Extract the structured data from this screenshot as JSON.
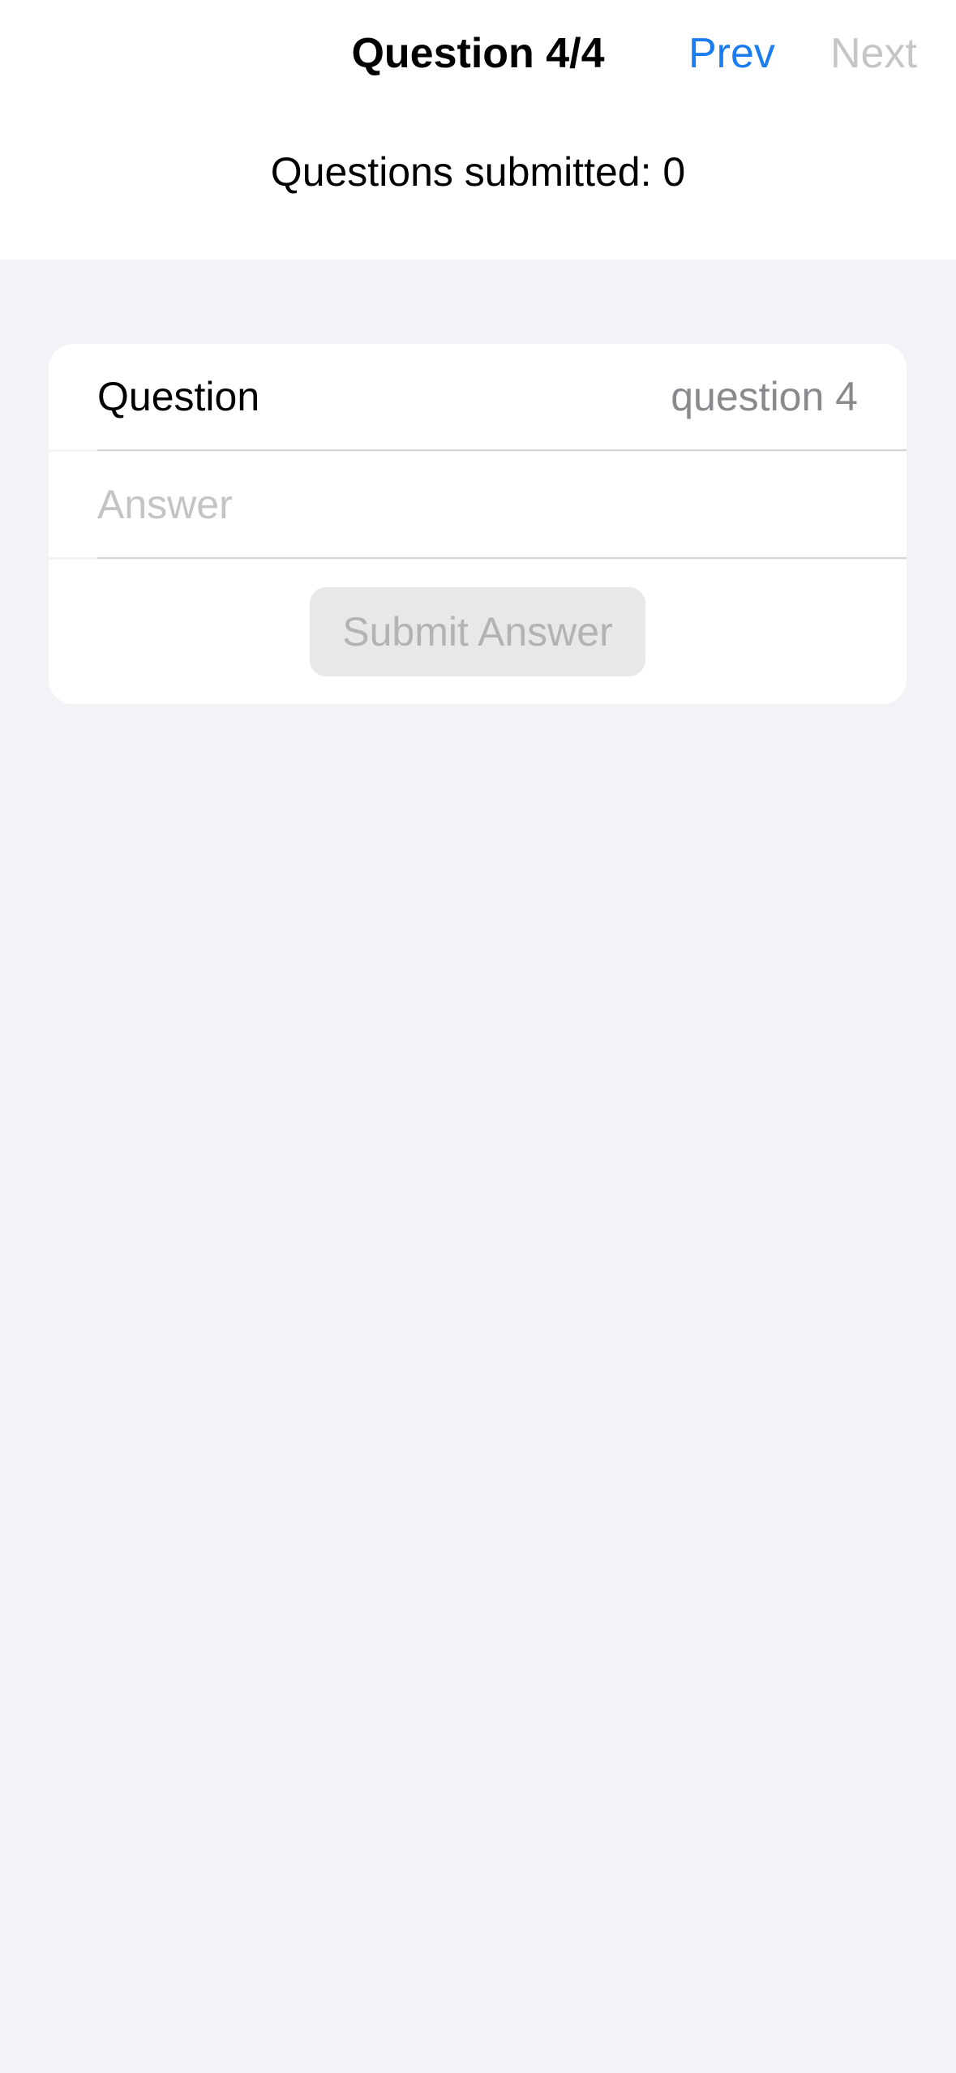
{
  "nav": {
    "title": "Question 4/4",
    "prev_label": "Prev",
    "next_label": "Next"
  },
  "status": {
    "submitted_text": "Questions submitted: 0"
  },
  "form": {
    "question_label": "Question",
    "question_value": "question 4",
    "answer_placeholder": "Answer",
    "answer_value": "",
    "submit_label": "Submit Answer"
  },
  "colors": {
    "accent": "#1a7cf0",
    "disabled_text": "#c5c5c7",
    "background": "#f2f2f7",
    "card": "#ffffff",
    "button_disabled_bg": "#e8e8ea"
  }
}
